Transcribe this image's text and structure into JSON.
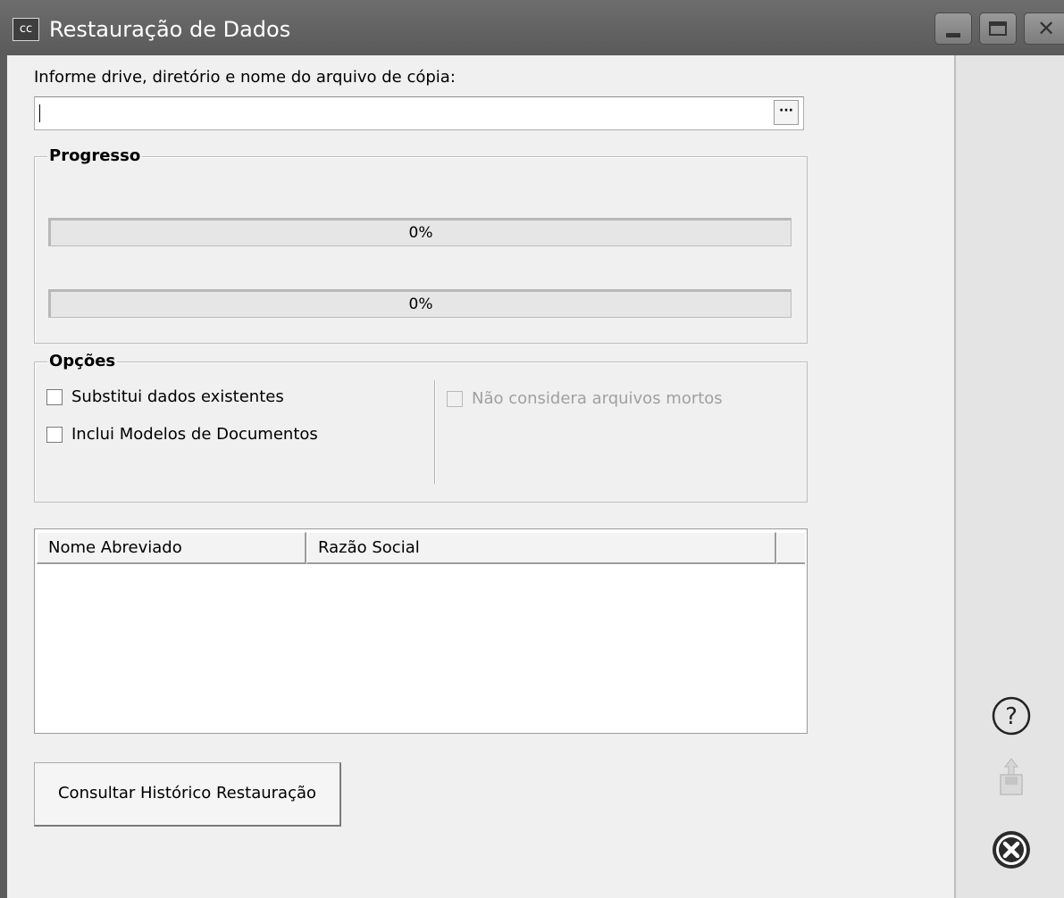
{
  "window": {
    "title": "Restauração de Dados",
    "app_icon_text": "cc"
  },
  "file": {
    "label": "Informe drive, diretório e nome do arquivo de cópia:",
    "value": "",
    "browse_label": "···"
  },
  "progress": {
    "title": "Progresso",
    "bars": [
      {
        "text": "0%",
        "value": 0
      },
      {
        "text": "0%",
        "value": 0
      }
    ]
  },
  "options": {
    "title": "Opções",
    "items": [
      {
        "label": "Substitui dados existentes",
        "checked": false,
        "enabled": true
      },
      {
        "label": "Inclui Modelos de Documentos",
        "checked": false,
        "enabled": true
      },
      {
        "label": "Não considera arquivos mortos",
        "checked": false,
        "enabled": false
      }
    ]
  },
  "table": {
    "columns": [
      "Nome Abreviado",
      "Razão Social"
    ],
    "rows": []
  },
  "buttons": {
    "history": "Consultar Histórico Restauração"
  },
  "side_icons": [
    "help-icon",
    "export-icon",
    "close-circle-icon"
  ],
  "colors": {
    "titlebar": "#5f5f5f",
    "window_bg": "#f0f0f0",
    "side_panel": "#e4e4e4"
  }
}
